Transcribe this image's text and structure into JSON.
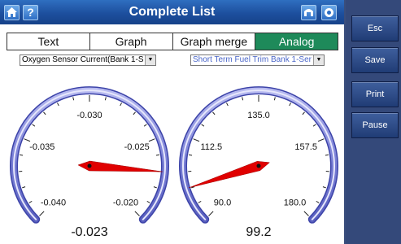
{
  "window": {
    "title": "Complete List"
  },
  "titlebar_icons": [
    "home-icon",
    "help-icon",
    "save-data-icon",
    "record-icon"
  ],
  "help_glyph": "?",
  "tabs": [
    {
      "label": "Text",
      "active": false
    },
    {
      "label": "Graph",
      "active": false
    },
    {
      "label": "Graph merge",
      "active": false
    },
    {
      "label": "Analog",
      "active": true
    }
  ],
  "selectors": {
    "left": "Oxygen Sensor Current(Bank 1-S",
    "right": "Short Term Fuel Trim Bank 1-Ser"
  },
  "sidebar": {
    "esc": "Esc",
    "save": "Save",
    "print": "Print",
    "pause": "Pause"
  },
  "gauges": [
    {
      "min": -0.04,
      "max": -0.02,
      "value": -0.023,
      "value_text": "-0.023",
      "tick_labels": [
        "-0.040",
        "-0.035",
        "-0.030",
        "-0.025",
        "-0.020"
      ]
    },
    {
      "min": 90.0,
      "max": 180.0,
      "value": 99.2,
      "value_text": "99.2",
      "tick_labels": [
        "90.0",
        "112.5",
        "135.0",
        "157.5",
        "180.0"
      ]
    }
  ],
  "colors": {
    "accent_tab": "#1e8a5a",
    "needle": "#e00000",
    "gauge_ring": "#8a8fd8",
    "sidebar": "#34497a",
    "titlebar": "#1d4f9e"
  }
}
